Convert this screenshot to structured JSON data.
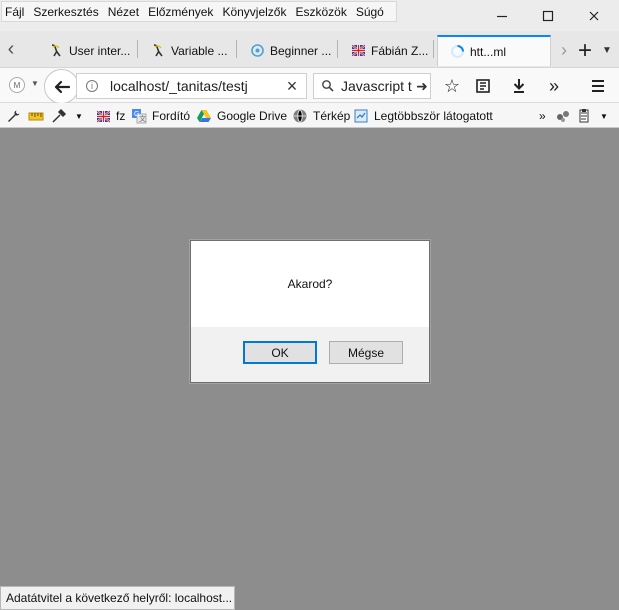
{
  "menu": {
    "items": [
      {
        "label": "Fájl"
      },
      {
        "label": "Szerkesztés"
      },
      {
        "label": "Nézet"
      },
      {
        "label": "Előzmények"
      },
      {
        "label": "Könyvjelzők"
      },
      {
        "label": "Eszközök"
      },
      {
        "label": "Súgó"
      }
    ]
  },
  "window_controls": {
    "minimize_icon": "minimize-icon",
    "maximize_icon": "maximize-icon",
    "close_icon": "close-icon"
  },
  "tabs": {
    "items": [
      {
        "label": "User inter...",
        "icon": "lambda-icon"
      },
      {
        "label": "Variable ...",
        "icon": "lambda-icon"
      },
      {
        "label": "Beginner ...",
        "icon": "target-icon"
      },
      {
        "label": "Fábián Z...",
        "icon": "flag-icon"
      },
      {
        "label": "htt...ml",
        "icon": "loading-icon",
        "active": true
      }
    ],
    "new_tab_icon": "plus-icon",
    "menu_icon": "chevron-down-icon"
  },
  "navigation": {
    "url_value": "localhost/_tanitas/testj",
    "search_value": "Javascript t",
    "icons": [
      "history-icon",
      "back-icon",
      "info-icon",
      "clear-icon",
      "search-icon",
      "arrow-right-icon",
      "star-icon",
      "reading-list-icon",
      "download-icon",
      "overflow-icon",
      "menu-icon"
    ]
  },
  "bookmarks": {
    "items": [
      {
        "label": "",
        "icon": "wrench-icon"
      },
      {
        "label": "",
        "icon": "ruler-icon"
      },
      {
        "label": "",
        "icon": "dropper-icon"
      },
      {
        "label": "fz",
        "icon": "flag-icon"
      },
      {
        "label": "Fordító",
        "icon": "translate-icon"
      },
      {
        "label": "Google Drive",
        "icon": "drive-icon"
      },
      {
        "label": "Térkép",
        "icon": "globe-icon"
      },
      {
        "label": "Legtöbbször látogatott",
        "icon": "bookmark-folder-icon"
      }
    ]
  },
  "dialog": {
    "message": "Akarod?",
    "ok_label": "OK",
    "cancel_label": "Mégse"
  },
  "status": {
    "text": "Adatátvitel a következő helyről: localhost..."
  },
  "colors": {
    "content_overlay": "#8d8d8d",
    "active_tab_accent": "#0a84ff",
    "dialog_focus": "#0078d7"
  }
}
